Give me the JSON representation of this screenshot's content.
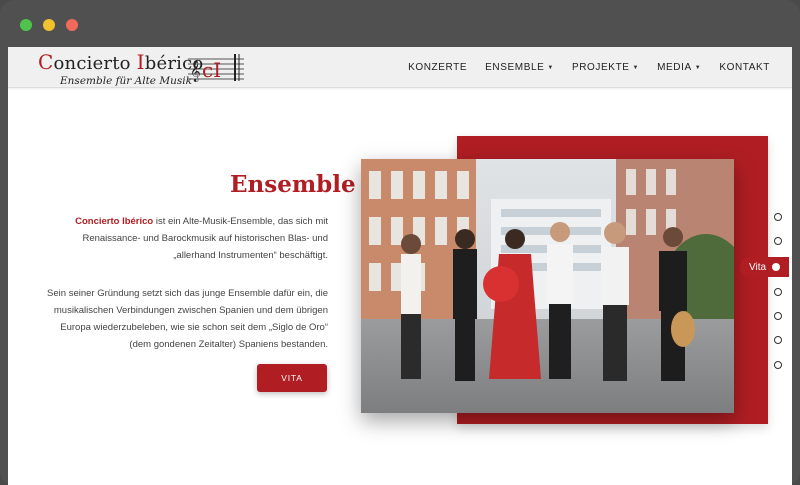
{
  "window": {
    "controls": [
      "window-dot-green",
      "window-dot-yellow",
      "window-dot-red"
    ]
  },
  "logo": {
    "title_cap1": "C",
    "title_part1": "oncierto ",
    "title_cap2": "I",
    "title_part2": "bérico",
    "subtitle": "Ensemble für Alte Musik",
    "mark_letters": "cI"
  },
  "nav": {
    "items": [
      {
        "label": "KONZERTE",
        "dropdown": false
      },
      {
        "label": "ENSEMBLE",
        "dropdown": true
      },
      {
        "label": "PROJEKTE",
        "dropdown": true
      },
      {
        "label": "MEDIA",
        "dropdown": true
      },
      {
        "label": "KONTAKT",
        "dropdown": false
      }
    ]
  },
  "content": {
    "heading": "Ensemble",
    "para1_brand": "Concierto Ibérico",
    "para1_text": " ist ein Alte-Musik-Ensemble, das sich mit Renaissance- und Barockmusik auf historischen Blas- und „allerhand Instrumenten“ beschäftigt.",
    "para2": "Sein seiner Gründung setzt sich das junge Ensemble dafür ein, die musikalischen Verbindungen zwischen Spanien und dem übrigen Europa wiederzubeleben, wie sie schon seit dem „Siglo de Oro“ (dem gondenen Zeitalter) Spaniens bestanden.",
    "button": "VITA"
  },
  "section_nav": {
    "active_label": "Vita"
  },
  "colors": {
    "accent": "#b01e23",
    "navbar": "#f0f0f0",
    "frame": "#505050"
  }
}
